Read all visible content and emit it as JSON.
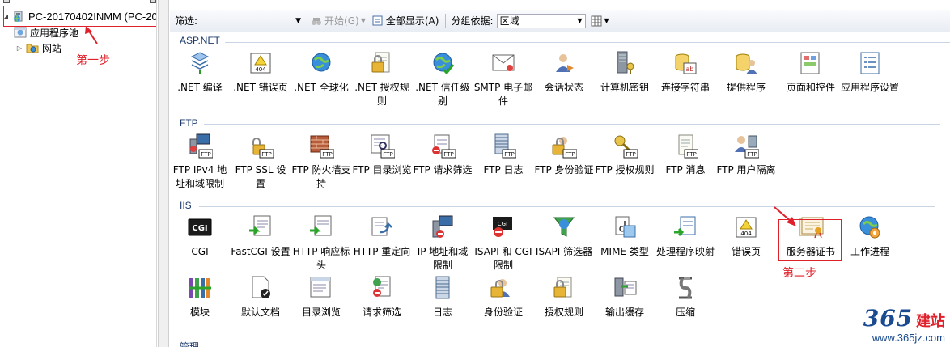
{
  "tree": {
    "server_label": "PC-20170402INMM (PC-20",
    "app_pools_label": "应用程序池",
    "sites_label": "网站",
    "step1_label": "第一步"
  },
  "toolbar": {
    "filter_label": "筛选:",
    "start_label": "开始(G)",
    "show_all_label": "全部显示(A)",
    "group_by_label": "分组依据:",
    "group_by_value": "区域"
  },
  "groups": {
    "aspnet": "ASP.NET",
    "ftp": "FTP",
    "iis": "IIS",
    "mgmt": "管理"
  },
  "features": {
    "aspnet": [
      {
        "label": ".NET 编译",
        "icon": "compile-icon"
      },
      {
        "label": ".NET 错误页",
        "icon": "error-page-icon"
      },
      {
        "label": ".NET 全球化",
        "icon": "globe-icon"
      },
      {
        "label": ".NET 授权规则",
        "icon": "lock-document-icon"
      },
      {
        "label": ".NET 信任级别",
        "icon": "trust-globe-icon"
      },
      {
        "label": "SMTP 电子邮件",
        "icon": "email-icon"
      },
      {
        "label": "会话状态",
        "icon": "session-icon"
      },
      {
        "label": "计算机密钥",
        "icon": "machine-key-icon"
      },
      {
        "label": "连接字符串",
        "icon": "connection-string-icon"
      },
      {
        "label": "提供程序",
        "icon": "providers-icon"
      },
      {
        "label": "页面和控件",
        "icon": "pages-controls-icon"
      },
      {
        "label": "应用程序设置",
        "icon": "app-settings-icon"
      }
    ],
    "ftp": [
      {
        "label": "FTP IPv4 地址和域限制",
        "icon": "ftp-ip-restrict-icon"
      },
      {
        "label": "FTP SSL 设置",
        "icon": "ftp-ssl-icon"
      },
      {
        "label": "FTP 防火墙支持",
        "icon": "ftp-firewall-icon"
      },
      {
        "label": "FTP 目录浏览",
        "icon": "ftp-dir-browse-icon"
      },
      {
        "label": "FTP 请求筛选",
        "icon": "ftp-request-filter-icon"
      },
      {
        "label": "FTP 日志",
        "icon": "ftp-log-icon"
      },
      {
        "label": "FTP 身份验证",
        "icon": "ftp-auth-icon"
      },
      {
        "label": "FTP 授权规则",
        "icon": "ftp-authz-icon"
      },
      {
        "label": "FTP 消息",
        "icon": "ftp-message-icon"
      },
      {
        "label": "FTP 用户隔离",
        "icon": "ftp-user-isolation-icon"
      }
    ],
    "iis_row1": [
      {
        "label": "CGI",
        "icon": "cgi-icon"
      },
      {
        "label": "FastCGI 设置",
        "icon": "fastcgi-icon"
      },
      {
        "label": "HTTP 响应标头",
        "icon": "http-headers-icon"
      },
      {
        "label": "HTTP 重定向",
        "icon": "http-redirect-icon"
      },
      {
        "label": "IP 地址和域限制",
        "icon": "ip-restrict-icon"
      },
      {
        "label": "ISAPI 和 CGI 限制",
        "icon": "isapi-cgi-icon"
      },
      {
        "label": "ISAPI 筛选器",
        "icon": "isapi-filter-icon"
      },
      {
        "label": "MIME 类型",
        "icon": "mime-icon"
      },
      {
        "label": "处理程序映射",
        "icon": "handler-map-icon"
      },
      {
        "label": "错误页",
        "icon": "error-page-icon"
      },
      {
        "label": "服务器证书",
        "icon": "certificate-icon"
      },
      {
        "label": "工作进程",
        "icon": "worker-process-icon"
      }
    ],
    "iis_row2": [
      {
        "label": "模块",
        "icon": "modules-icon"
      },
      {
        "label": "默认文档",
        "icon": "default-doc-icon"
      },
      {
        "label": "目录浏览",
        "icon": "dir-browse-icon"
      },
      {
        "label": "请求筛选",
        "icon": "request-filter-icon"
      },
      {
        "label": "日志",
        "icon": "log-icon"
      },
      {
        "label": "身份验证",
        "icon": "auth-icon"
      },
      {
        "label": "授权规则",
        "icon": "authz-icon"
      },
      {
        "label": "输出缓存",
        "icon": "output-cache-icon"
      },
      {
        "label": "压缩",
        "icon": "compression-icon"
      }
    ]
  },
  "annotations": {
    "step2_label": "第二步"
  },
  "watermark": {
    "digits": "365",
    "brand": "建站",
    "url": "www.365jz.com"
  },
  "colors": {
    "annotation_red": "#e0202a",
    "group_header": "#1b3a6b",
    "watermark_blue": "#1a4a8f"
  }
}
